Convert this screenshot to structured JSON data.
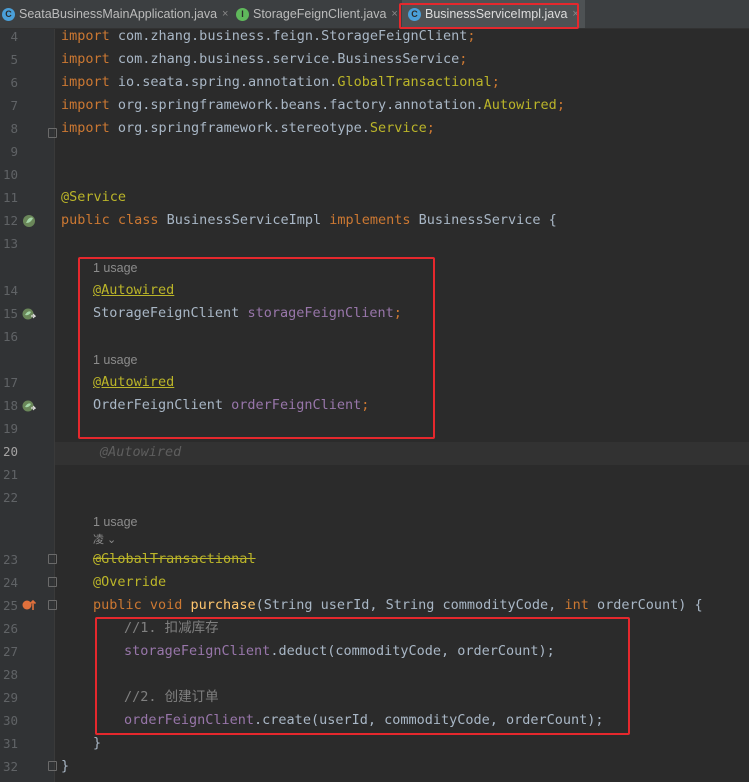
{
  "tabs": [
    {
      "label": "SeataBusinessMainApplication.java",
      "icon_color": "#4a9fd8",
      "icon": "C"
    },
    {
      "label": "StorageFeignClient.java",
      "icon_color": "#5fb85b",
      "icon": "I"
    },
    {
      "label": "BusinessServiceImpl.java",
      "icon_color": "#4a9fd8",
      "icon": "C"
    }
  ],
  "close_glyph": "×",
  "line_numbers": [
    "4",
    "5",
    "6",
    "7",
    "8",
    "9",
    "10",
    "11",
    "12",
    "13",
    "14",
    "15",
    "16",
    "17",
    "18",
    "19",
    "20",
    "21",
    "22",
    "23",
    "24",
    "25",
    "26",
    "27",
    "28",
    "29",
    "30",
    "31",
    "32"
  ],
  "code": {
    "imp_kw": "import",
    "line4": " com.zhang.business.feign.StorageFeignClient",
    "line5": " com.zhang.business.service.BusinessService",
    "line6_pkg": " io.seata.spring.annotation.",
    "line6_cls": "GlobalTransactional",
    "line7_pkg": " org.springframework.beans.factory.annotation.",
    "line7_cls": "Autowired",
    "line8_pkg": " org.springframework.stereotype.",
    "line8_cls": "Service",
    "semi": ";",
    "service_ann": "@Service",
    "class_kw": "public class",
    "class_name": " BusinessServiceImpl ",
    "implements_kw": "implements",
    "iface": " BusinessService {",
    "usage1": "1 usage",
    "autowired": "@Autowired",
    "storage_type": "StorageFeignClient ",
    "storage_field": "storageFeignClient",
    "usage2": "1 usage",
    "order_type": "OrderFeignClient ",
    "order_field": "orderFeignClient",
    "ghost_autowired": "@Autowired",
    "usage3": "1 usage",
    "author_hint": "凌 ⌄",
    "global_tx": "@GlobalTransactional",
    "override": "@Override",
    "public_void": "public void ",
    "method_name": "purchase",
    "method_params_a": "(String userId, String commodityCode, ",
    "int_kw": "int",
    "method_params_b": " orderCount) {",
    "comment1": "//1. 扣减库存",
    "deduct_call": ".deduct(commodityCode, orderCount);",
    "comment2": "//2. 创建订单",
    "create_call": ".create(userId, commodityCode, orderCount);",
    "close_method": "}",
    "close_class": "}"
  }
}
